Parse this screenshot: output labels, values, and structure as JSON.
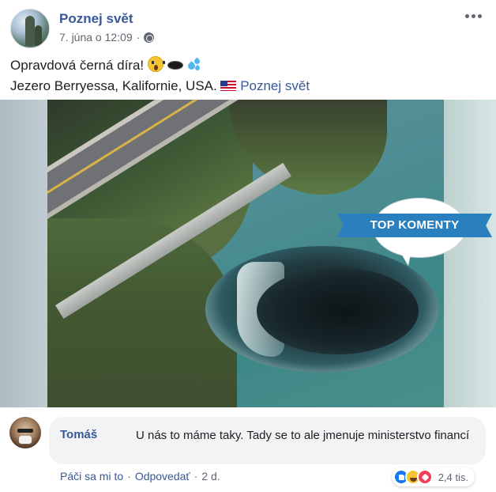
{
  "post": {
    "page_name": "Poznej svět",
    "date": "7. júna o 12:09",
    "separator": "·",
    "text_line1": "Opravdová černá díra!",
    "text_line2": "Jezero Berryessa, Kalifornie, USA.",
    "text_link": "Poznej svět",
    "icons": [
      "globe-icon",
      "more-options-icon",
      "scream-emoji",
      "hole-emoji",
      "droplets-emoji",
      "us-flag-emoji"
    ]
  },
  "media": {
    "badge_text": "TOP KOMENTY"
  },
  "comment": {
    "author": "Tomáš",
    "text": "U nás to máme taky. Tady se to ale jmenuje ministerstvo financí",
    "reaction_count": "2,4 tis.",
    "reaction_icons": [
      "like-icon",
      "haha-icon",
      "love-icon"
    ],
    "actions": {
      "like": "Páči sa mi to",
      "reply": "Odpovedať",
      "time": "2 d.",
      "separator": "·"
    }
  },
  "colors": {
    "link": "#385898",
    "meta": "#616770",
    "badge": "#2a7fbf",
    "comment_bg": "#f2f3f5"
  }
}
